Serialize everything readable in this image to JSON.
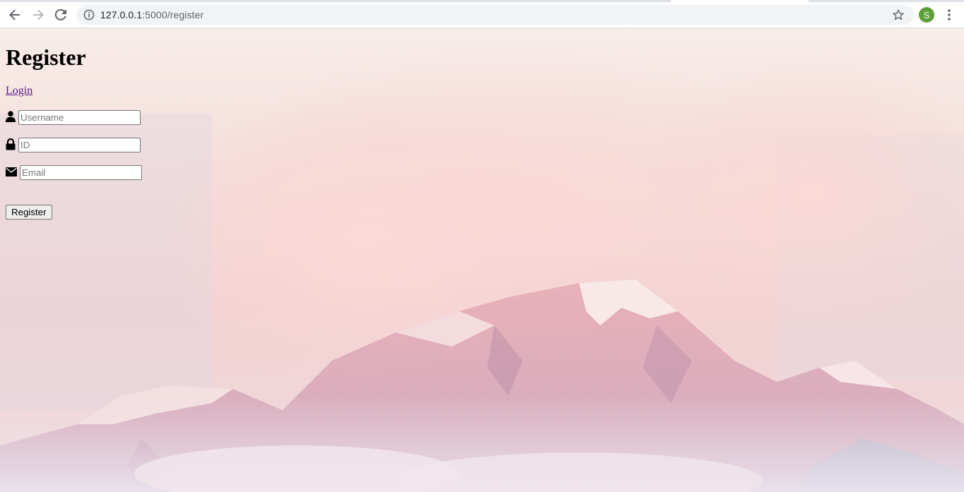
{
  "browser": {
    "url_host": "127.0.0.1",
    "url_path": ":5000/register",
    "profile_initial": "S",
    "icons": {
      "back": "arrow-left-icon",
      "forward": "arrow-right-icon",
      "reload": "reload-icon",
      "site_info": "info-icon",
      "bookmark": "star-icon",
      "menu": "more-vert-icon"
    },
    "avatar_color": "#5e9f3a"
  },
  "page": {
    "title": "Register",
    "login_link": "Login",
    "fields": [
      {
        "icon": "user-icon",
        "placeholder": "Username",
        "value": ""
      },
      {
        "icon": "lock-icon",
        "placeholder": "ID",
        "value": ""
      },
      {
        "icon": "envelope-icon",
        "placeholder": "Email",
        "value": ""
      }
    ],
    "submit_label": "Register",
    "link_color": "#551a8b"
  }
}
